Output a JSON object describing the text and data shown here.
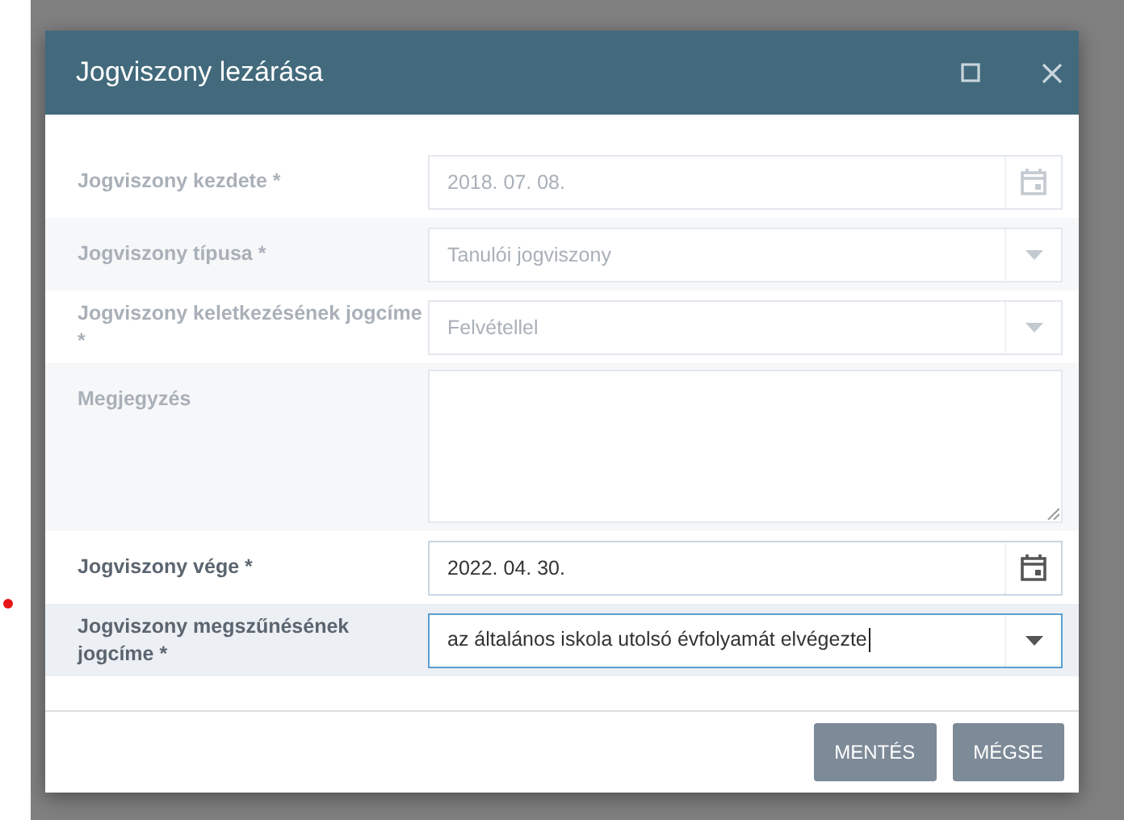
{
  "dialog": {
    "title": "Jogviszony lezárása",
    "fields": [
      {
        "label": "Jogviszony kezdete *",
        "kind": "date",
        "value": "2018. 07. 08.",
        "disabled": true,
        "focused": false
      },
      {
        "label": "Jogviszony típusa *",
        "kind": "select",
        "value": "Tanulói jogviszony",
        "disabled": true,
        "focused": false
      },
      {
        "label": "Jogviszony keletkezésének jogcíme *",
        "kind": "select",
        "value": "Felvétellel",
        "disabled": true,
        "focused": false
      },
      {
        "label": "Megjegyzés",
        "kind": "textarea",
        "disabled": true,
        "focused": false
      },
      {
        "label": "Jogviszony vége *",
        "kind": "date",
        "value": "2022. 04. 30.",
        "disabled": false,
        "focused": false
      },
      {
        "label": "Jogviszony megszűnésének jogcíme *",
        "kind": "select",
        "value": "az általános iskola utolsó évfolyamát elvégezte",
        "disabled": false,
        "focused": true
      }
    ],
    "buttons": [
      "MENTÉS",
      "MÉGSE"
    ]
  }
}
